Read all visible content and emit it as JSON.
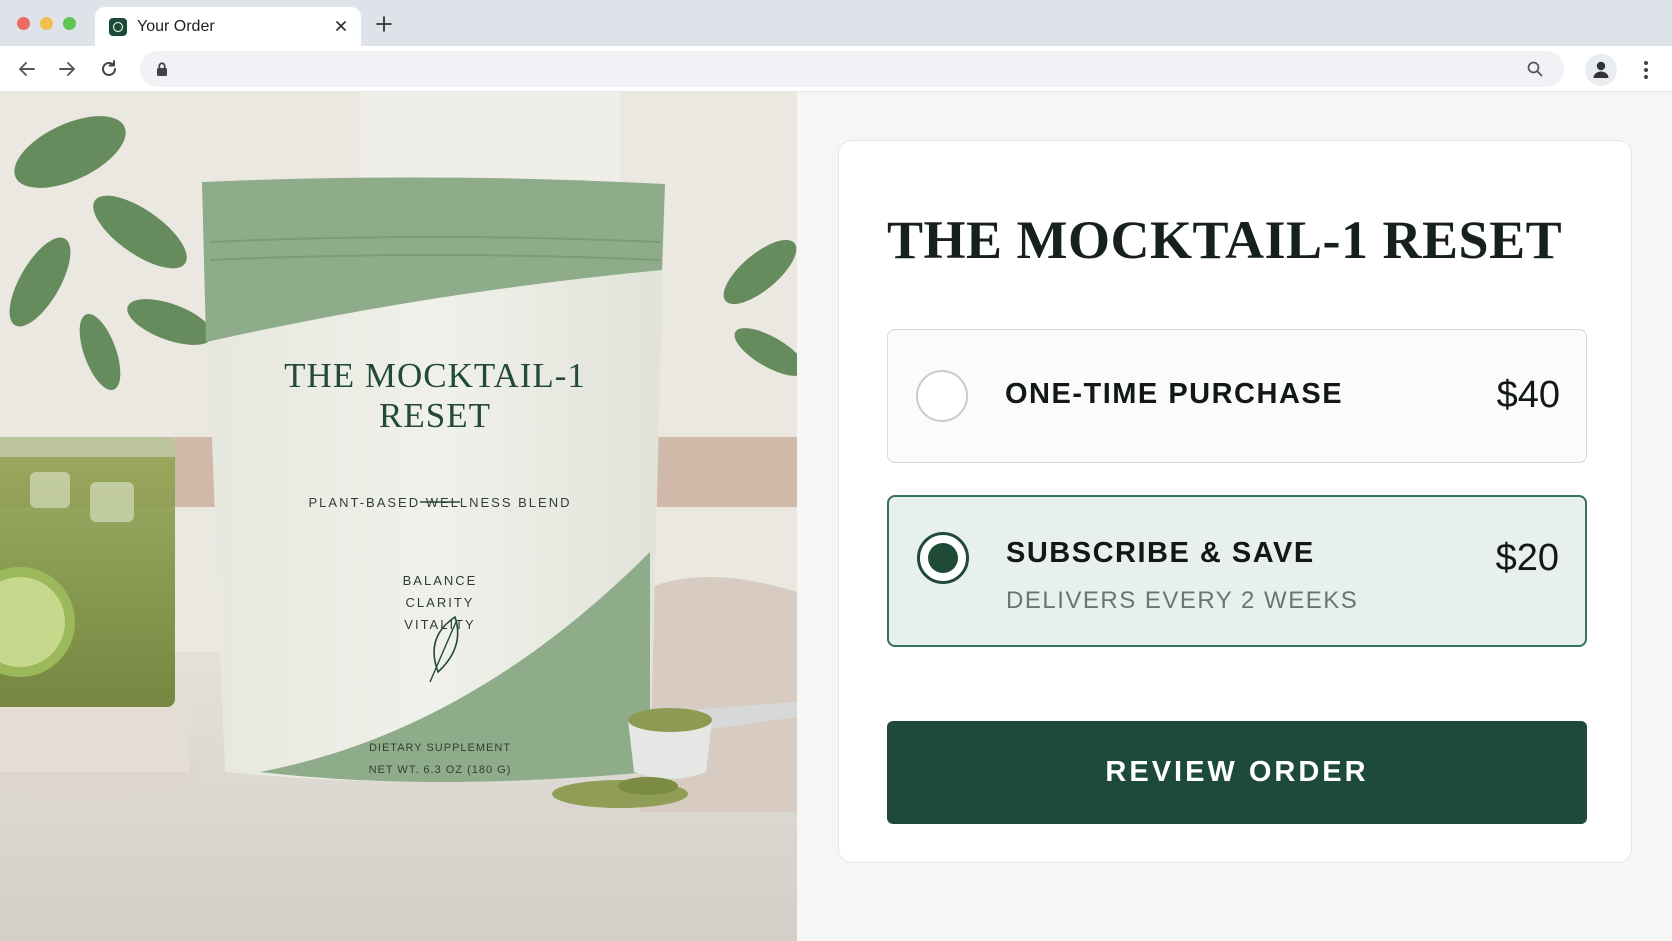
{
  "browser": {
    "tab_title": "Your Order",
    "url": ""
  },
  "hero": {
    "pouch": {
      "title": "THE MOCKTAIL-1 RESET",
      "subtitle": "PLANT-BASED WELLNESS BLEND",
      "words": [
        "BALANCE",
        "CLARITY",
        "VITALITY"
      ],
      "footer_line1": "DIETARY SUPPLEMENT",
      "footer_line2": "NET WT. 6.3 OZ (180 G)"
    }
  },
  "order": {
    "product_title": "THE MOCKTAIL-1 RESET",
    "options": [
      {
        "label": "ONE-TIME PURCHASE",
        "price": "$40",
        "note": "",
        "selected": false
      },
      {
        "label": "SUBSCRIBE & SAVE",
        "price": "$20",
        "note": "DELIVERS EVERY 2 WEEKS",
        "selected": true
      }
    ],
    "cta": "REVIEW ORDER"
  },
  "colors": {
    "brand_green": "#1d4a3a",
    "selected_bg": "#e8f0eb",
    "pouch_sage": "#8fac8a"
  }
}
